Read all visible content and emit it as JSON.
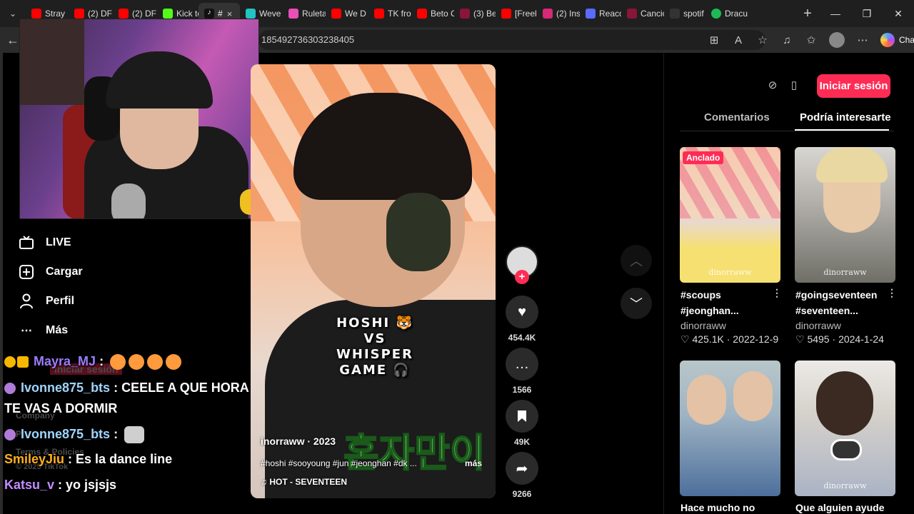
{
  "browser": {
    "tabs": [
      {
        "label": "Stray",
        "color": "#ff0000"
      },
      {
        "label": "(2) DF",
        "color": "#ff0000"
      },
      {
        "label": "(2) DF",
        "color": "#ff0000"
      },
      {
        "label": "Kick te",
        "color": "#53fc18"
      },
      {
        "label": "#",
        "color": "#000000",
        "active": true
      },
      {
        "label": "Weve",
        "color": "#22c3c3"
      },
      {
        "label": "Ruleta",
        "color": "#e84fb7"
      },
      {
        "label": "We D",
        "color": "#ff0000"
      },
      {
        "label": "TK fro",
        "color": "#ff0000"
      },
      {
        "label": "Beto C",
        "color": "#ff0000"
      },
      {
        "label": "(3) Be",
        "color": "#8a1538"
      },
      {
        "label": "[Freel",
        "color": "#ff0000"
      },
      {
        "label": "(2) Ins",
        "color": "#d62976"
      },
      {
        "label": "Reacc",
        "color": "#5a6bff"
      },
      {
        "label": "Cancio",
        "color": "#8a1538"
      },
      {
        "label": "spotif",
        "color": "#333333"
      },
      {
        "label": "Dracu",
        "color": "#1db954"
      }
    ],
    "active_tab_close": "×",
    "new_tab": "+",
    "url": "185492736303238405",
    "chat_label": "Chat"
  },
  "nav": {
    "live": "LIVE",
    "upload": "Cargar",
    "profile": "Perfil",
    "more": "Más"
  },
  "faded_footer": {
    "login": "Iniciar sesión",
    "company": "Company",
    "program": "P",
    "terms": "Terms & Policies",
    "copyright": "© 2025 TikTok"
  },
  "chat": [
    {
      "user": "Mayra_MJ",
      "user_color": "#9b7cff",
      "message": " : ",
      "emotes": 4
    },
    {
      "user": "Ivonne875_bts",
      "user_color": "#9fd4ff",
      "message": " : CEELE A QUE HORA"
    },
    {
      "user": "",
      "user_color": "#ffffff",
      "message": "TE VAS A DORMIR"
    },
    {
      "user": "Ivonne875_bts",
      "user_color": "#9fd4ff",
      "message": " : "
    },
    {
      "user": "SmileyJiu",
      "user_color": "#ffb020",
      "message": " : Es la dance line"
    },
    {
      "user": "Katsu_v",
      "user_color": "#c38bff",
      "message": " : yo jsjsjs"
    }
  ],
  "video": {
    "overlay_line1": "HOSHI 🐯",
    "overlay_line2": "VS",
    "overlay_line3": "WHISPER GAME 🎧",
    "korean_text": "혼자만이",
    "author_date": "inorraww · 2023",
    "hashtags": "#hoshi #sooyoung #jun #jeonghan #dk ...",
    "more": "más",
    "music": "HOT - SEVENTEEN"
  },
  "actions": {
    "likes": "454.4K",
    "comments": "1566",
    "saves": "49K",
    "shares": "9266"
  },
  "right": {
    "login": "Iniciar sesión",
    "tab_comments": "Comentarios",
    "tab_suggest": "Podría interesarte",
    "videos": [
      {
        "pinned": "Anclado",
        "title": "#scoups #jeonghan...",
        "user": "dinorraww",
        "likes": "425.1K",
        "date": "2022-12-9",
        "watermark": "dinorraww"
      },
      {
        "pinned": "",
        "title": "#goingseventeen #seventeen...",
        "user": "dinorraww",
        "likes": "5495",
        "date": "2024-1-24",
        "watermark": "dinorraww"
      },
      {
        "pinned": "",
        "title": "Hace mucho no",
        "user": "",
        "likes": "",
        "date": "",
        "watermark": ""
      },
      {
        "pinned": "",
        "title": "Que alguien ayude",
        "user": "",
        "likes": "",
        "date": "",
        "watermark": "dinorraww"
      }
    ]
  },
  "colors": {
    "accent": "#fe2c55",
    "background": "#000000"
  }
}
